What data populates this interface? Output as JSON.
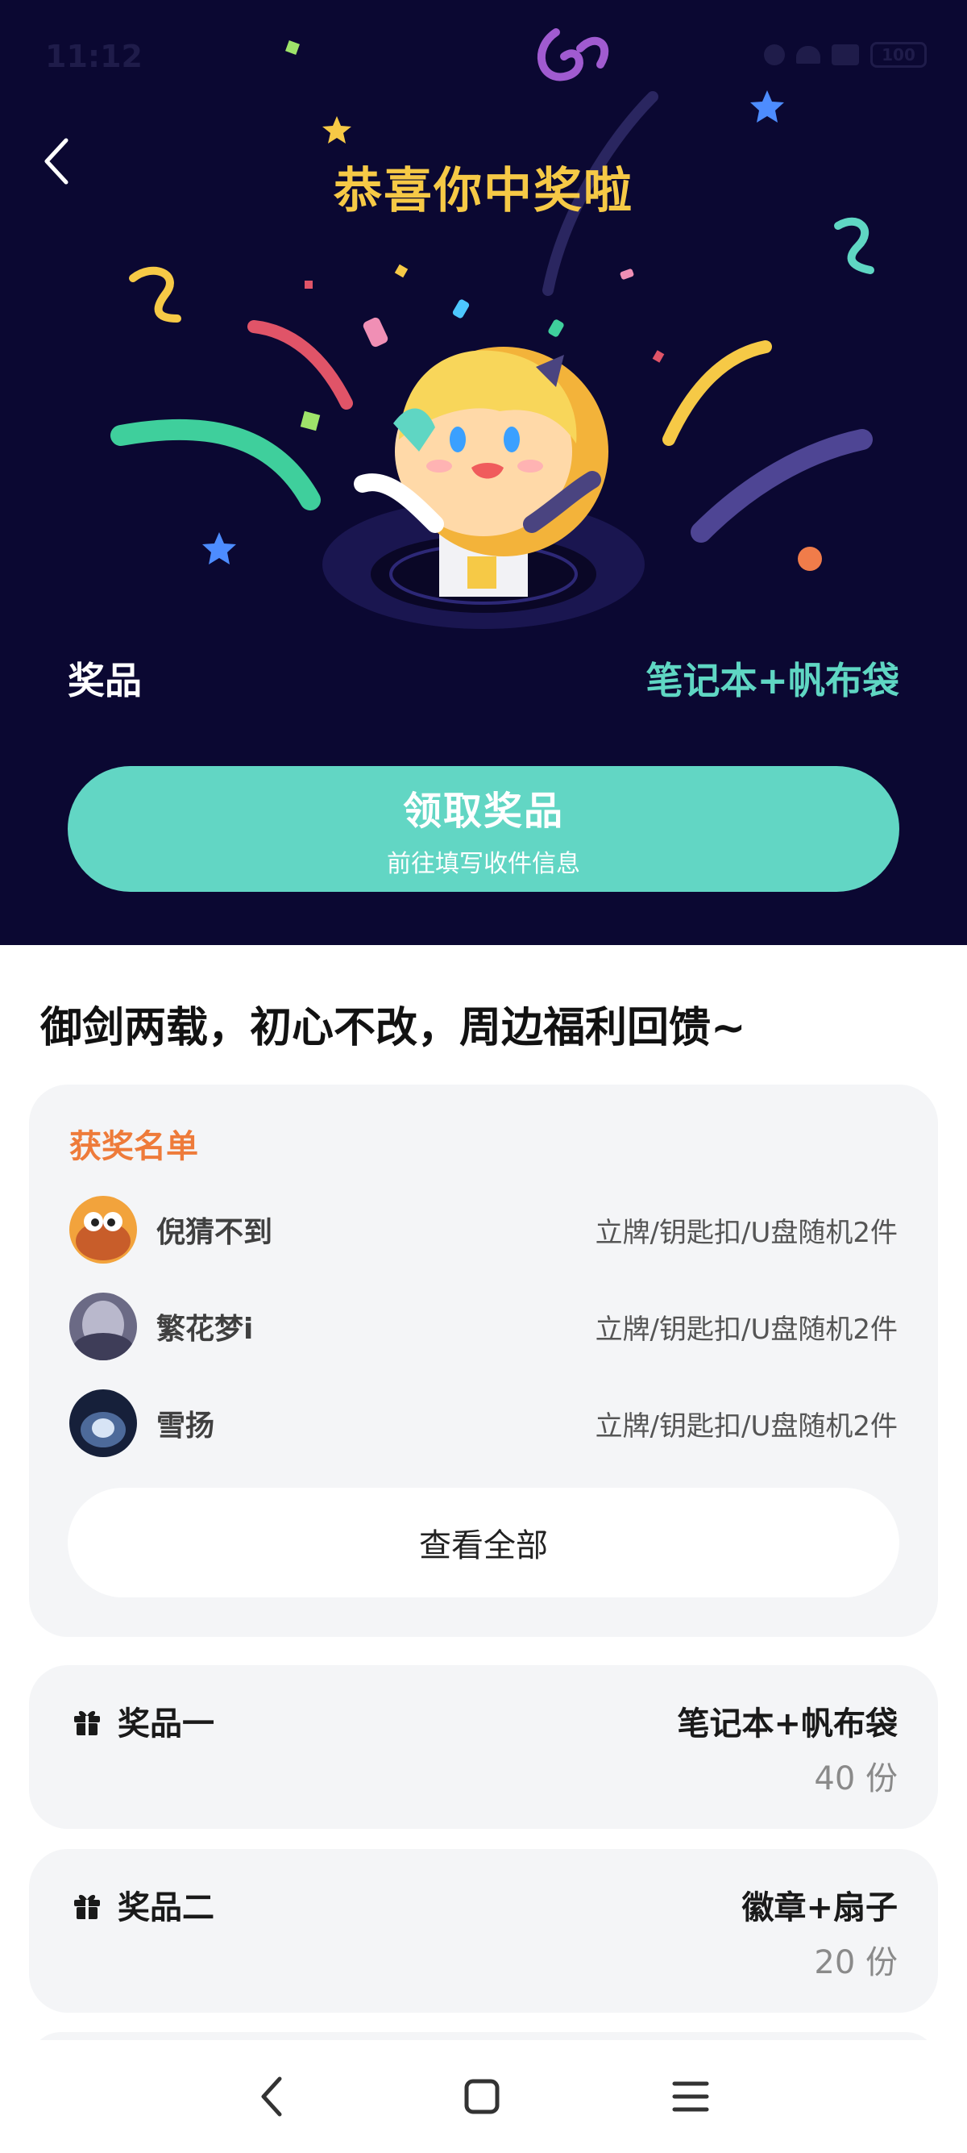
{
  "status_bar": {
    "time": "11:12",
    "battery": "100"
  },
  "hero": {
    "title": "恭喜你中奖啦",
    "prize_label": "奖品",
    "prize_value": "笔记本+帆布袋",
    "claim_button": {
      "label": "领取奖品",
      "sublabel": "前往填写收件信息"
    }
  },
  "section_title": "御剑两载，初心不改，周边福利回馈~",
  "winners": {
    "title": "获奖名单",
    "rows": [
      {
        "name": "倪猜不到",
        "prize": "立牌/钥匙扣/U盘随机2件"
      },
      {
        "name": "繁花梦i",
        "prize": "立牌/钥匙扣/U盘随机2件"
      },
      {
        "name": "雪扬",
        "prize": "立牌/钥匙扣/U盘随机2件"
      }
    ],
    "view_all": "查看全部"
  },
  "prizes": [
    {
      "name": "奖品一",
      "item": "笔记本+帆布袋",
      "quantity": "40 份"
    },
    {
      "name": "奖品二",
      "item": "徽章+扇子",
      "quantity": "20 份"
    }
  ],
  "icons": {
    "back": "chevron-left-icon",
    "gift": "gift-icon",
    "nav_back": "nav-back-icon",
    "nav_home": "nav-home-icon",
    "nav_menu": "nav-menu-icon"
  },
  "colors": {
    "hero_bg": "#0b0832",
    "title_gold": "#f6c946",
    "accent_teal": "#62d6c4",
    "winners_orange": "#ee7b3a",
    "card_bg": "#f4f5f7"
  }
}
